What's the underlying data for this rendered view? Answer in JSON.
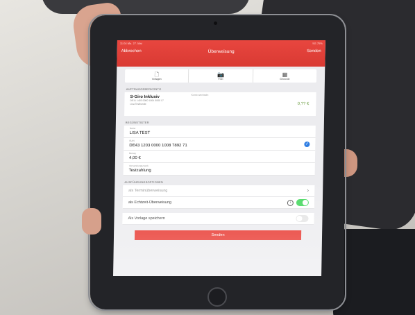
{
  "status": {
    "left": "11:04  Mo. 27. Mai",
    "right": "5G 75%"
  },
  "nav": {
    "cancel": "Abbrechen",
    "title": "Überweisung",
    "send": "Senden"
  },
  "toolbar": [
    {
      "icon": "document-icon",
      "glyph": "🗋",
      "label": "Vorlagen"
    },
    {
      "icon": "photo-icon",
      "glyph": "📷",
      "label": "Foto"
    },
    {
      "icon": "qr-code-icon",
      "glyph": "▦",
      "label": "Girocode"
    }
  ],
  "sections": {
    "account": "AUFTRAGGEBERKONTO",
    "recipient": "BEGÜNSTIGTER",
    "options": "AUSFÜHRUNGSOPTIONEN"
  },
  "account": {
    "change": "Konto wechseln",
    "name": "S-Giro Inklusiv",
    "iban": "DE11 1403 0000 1004 0000 17",
    "owner": "Lisa Testkunde",
    "balance": "0,?? €"
  },
  "fields": [
    {
      "label": "Name",
      "value": "LISA TEST"
    },
    {
      "label": "IBAN",
      "value": "DE43 1203 0000 1008 7892 71"
    },
    {
      "label": "Betrag",
      "value": "4,00 €"
    },
    {
      "label": "Verwendungszweck",
      "value": "Testzahlung"
    }
  ],
  "options": {
    "scheduled": "als Terminüberweisung",
    "instant": "als Echtzeit-Überweisung",
    "template": "Als Vorlage speichern",
    "instant_on": true,
    "template_on": false
  },
  "send_button": "Senden",
  "colors": {
    "accent": "#e8352d",
    "toggle_on": "#4cd964",
    "check": "#2f7ee3"
  }
}
